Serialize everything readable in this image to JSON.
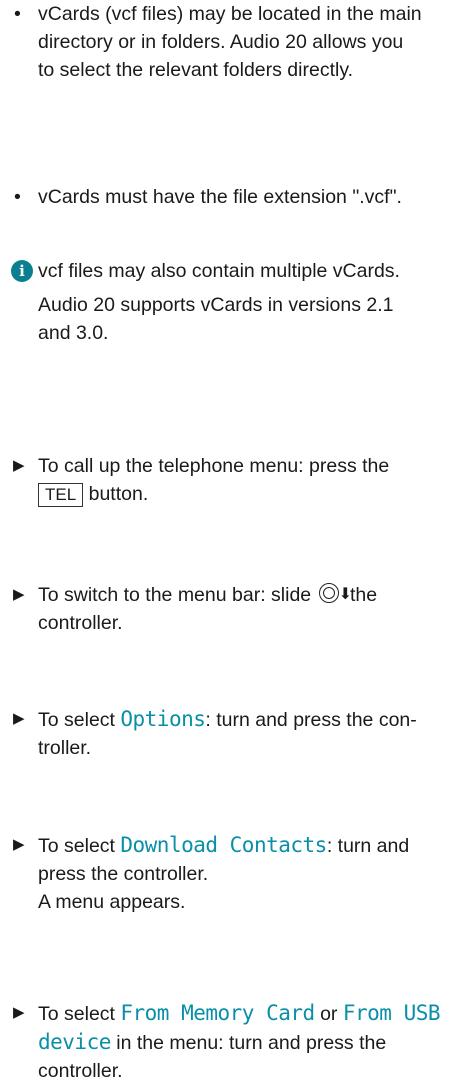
{
  "bullets": [
    [
      "vCards (vcf files) may be located in the main",
      "directory or in folders. Audio 20 allows you",
      "to select the relevant folders directly."
    ],
    [
      "vCards must have the file extension \".vcf\"."
    ]
  ],
  "info": {
    "line1": "vcf files may also contain multiple vCards.",
    "line2": "Audio 20 supports vCards in versions 2.1",
    "line3": "and 3.0."
  },
  "steps": {
    "s1": {
      "pre": "To call up the telephone menu: press the",
      "key": "TEL",
      "post": " button."
    },
    "s2": {
      "pre": "To switch to the menu bar: slide ",
      "post": " the",
      "line2": "controller."
    },
    "s3": {
      "pre": "To select ",
      "term": "Options",
      "post": ": turn and press the con-",
      "line2": "troller."
    },
    "s4": {
      "pre": "To select ",
      "term": "Download Contacts",
      "post": ": turn and",
      "line2": "press the controller.",
      "line3": "A menu appears."
    },
    "s5": {
      "pre": "To select ",
      "term1": "From Memory Card",
      "mid": " or ",
      "term2": "From USB",
      "term2b": "device",
      "post": " in the menu: turn and press the",
      "line3": "controller."
    }
  }
}
